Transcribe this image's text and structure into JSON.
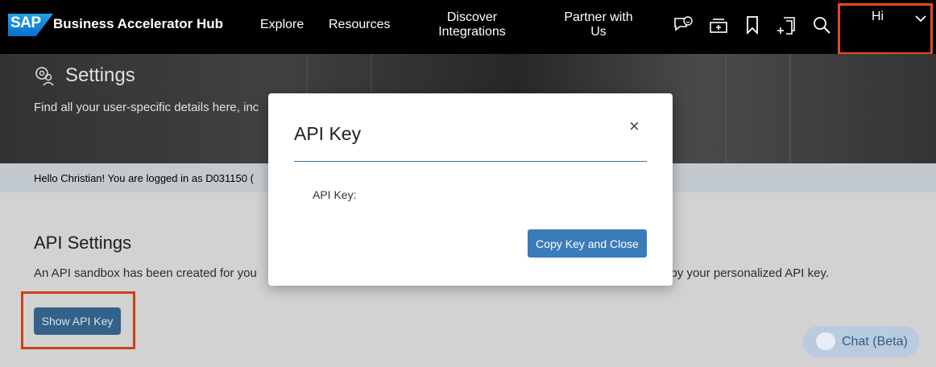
{
  "header": {
    "logo": "SAP",
    "brand": "Business Accelerator Hub",
    "nav": [
      {
        "label": "Explore"
      },
      {
        "label": "Resources"
      },
      {
        "label": "Discover Integrations"
      },
      {
        "label": "Partner with Us"
      }
    ],
    "icons": [
      "feedback-icon",
      "add-to-list-icon",
      "bookmark-icon",
      "add-content-icon",
      "search-icon"
    ],
    "user": {
      "greeting": "Hi"
    }
  },
  "hero": {
    "title": "Settings",
    "subtitle": "Find all your user-specific details here, inc"
  },
  "infobar": {
    "text": "Hello Christian! You are logged in as D031150 ("
  },
  "api_section": {
    "title": "API Settings",
    "text_left": "An API sandbox has been created for you",
    "text_right": "d by your personalized API key.",
    "button_label": "Show API Key"
  },
  "modal": {
    "title": "API Key",
    "close": "×",
    "field_label": "API Key:",
    "button_label": "Copy Key and Close"
  },
  "chat": {
    "label": "Chat (Beta)"
  },
  "colors": {
    "accent": "#3a7cb9",
    "highlight": "#e8491e"
  }
}
